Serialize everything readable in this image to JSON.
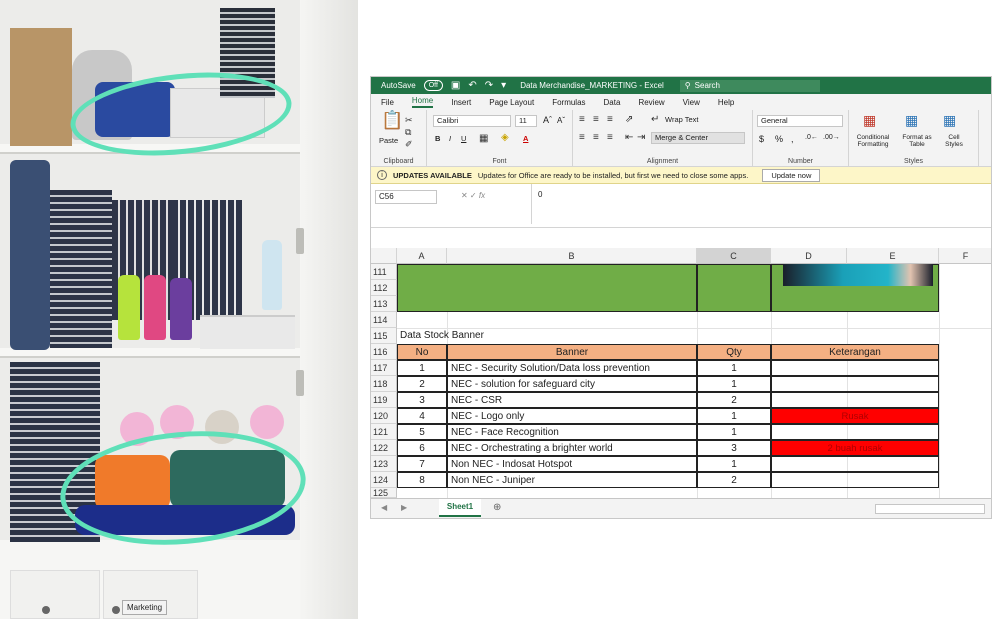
{
  "photo": {
    "marketing_label": "Marketing"
  },
  "excel": {
    "autosave_label": "AutoSave",
    "autosave_state": "Off",
    "doc_title": "Data Merchandise_MARKETING - Excel",
    "search_placeholder": "Search",
    "tabs": [
      "File",
      "Home",
      "Insert",
      "Page Layout",
      "Formulas",
      "Data",
      "Review",
      "View",
      "Help"
    ],
    "active_tab": "Home",
    "ribbon": {
      "paste": "Paste",
      "clipboard": "Clipboard",
      "font_name": "Calibri",
      "font_size": "11",
      "font_group": "Font",
      "wrap_text": "Wrap Text",
      "merge_center": "Merge & Center",
      "alignment_group": "Alignment",
      "number_format": "General",
      "number_group": "Number",
      "conditional_formatting": "Conditional Formatting",
      "format_as_table": "Format as Table",
      "cell_styles": "Cell Styles",
      "styles_group": "Styles"
    },
    "message_bar": {
      "title": "UPDATES AVAILABLE",
      "text": "Updates for Office are ready to be installed, but first we need to close some apps.",
      "button": "Update now"
    },
    "name_box": "C56",
    "formula_value": "0",
    "columns": [
      "A",
      "B",
      "C",
      "D",
      "E",
      "F"
    ],
    "section_title": "Data Stock Banner",
    "table_headers": {
      "no": "No",
      "banner": "Banner",
      "qty": "Qty",
      "keterangan": "Keterangan"
    },
    "rows_top": [
      "111",
      "112",
      "113",
      "114"
    ],
    "row_title_num": "115",
    "row_header_num": "116",
    "table_rows": [
      {
        "row": "117",
        "no": "1",
        "banner": "NEC - Security Solution/Data loss prevention",
        "qty": "1",
        "keterangan": ""
      },
      {
        "row": "118",
        "no": "2",
        "banner": "NEC - solution for safeguard city",
        "qty": "1",
        "keterangan": ""
      },
      {
        "row": "119",
        "no": "3",
        "banner": "NEC - CSR",
        "qty": "2",
        "keterangan": ""
      },
      {
        "row": "120",
        "no": "4",
        "banner": "NEC - Logo only",
        "qty": "1",
        "keterangan": "Rusak"
      },
      {
        "row": "121",
        "no": "5",
        "banner": "NEC - Face Recognition",
        "qty": "1",
        "keterangan": ""
      },
      {
        "row": "122",
        "no": "6",
        "banner": "NEC - Orchestrating a brighter world",
        "qty": "3",
        "keterangan": "2 buah rusak"
      },
      {
        "row": "123",
        "no": "7",
        "banner": "Non NEC - Indosat Hotspot",
        "qty": "1",
        "keterangan": ""
      },
      {
        "row": "124",
        "no": "8",
        "banner": "Non NEC - Juniper",
        "qty": "2",
        "keterangan": ""
      }
    ],
    "row_last": "125",
    "sheet_tab": "Sheet1",
    "colors": {
      "excel_green": "#217346",
      "cell_green": "#70ad47",
      "header_peach": "#f4b083",
      "alert_red": "#ff0000",
      "highlight_mint": "#5fe0b8"
    }
  }
}
